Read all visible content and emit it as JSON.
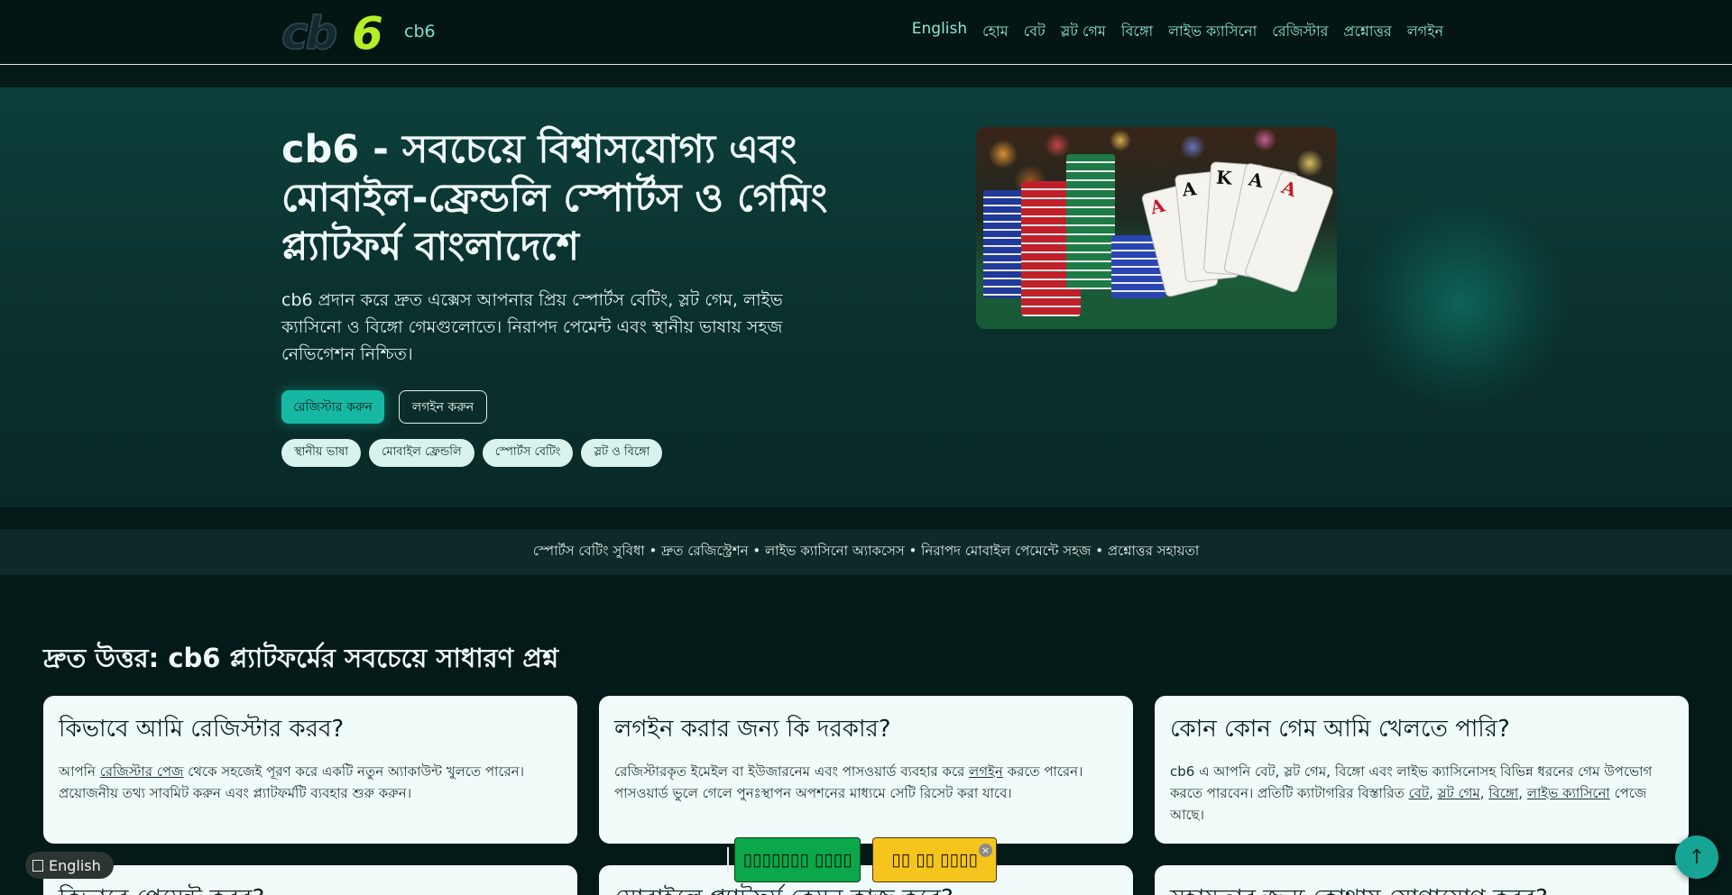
{
  "header": {
    "logo_text": "cb6",
    "brand": "cb6",
    "nav": {
      "language": "English",
      "home": "হোম",
      "bet": "বেট",
      "slot": "স্লট গেম",
      "bingo": "বিঙ্গো",
      "live_casino": "লাইভ ক্যাসিনো",
      "register": "রেজিস্টার",
      "faq": "প্রশ্নোত্তর",
      "login": "লগইন"
    }
  },
  "hero": {
    "title": "cb6 - সবচেয়ে বিশ্বাসযোগ্য এবং মোবাইল-ফ্রেন্ডলি স্পোর্টস ও গেমিং প্ল্যাটফর্ম বাংলাদেশে",
    "description": "cb6 প্রদান করে দ্রুত এক্সেস আপনার প্রিয় স্পোর্টস বেটিং, স্লট গেম, লাইভ ক্যাসিনো ও বিঙ্গো গেমগুলোতে। নিরাপদ পেমেন্ট এবং স্থানীয় ভাষায় সহজ নেভিগেশন নিশ্চিত।",
    "register_button": "রেজিস্টার করুন",
    "login_button": "লগইন করুন",
    "chips": [
      "স্থানীয় ভাষা",
      "মোবাইল ফ্রেন্ডলি",
      "স্পোর্টস বেটিং",
      "স্লট ও বিঙ্গো"
    ]
  },
  "ticker": "স্পোর্টস বেটিং সুবিধা • দ্রুত রেজিস্ট্রেশন • লাইভ ক্যাসিনো অ্যাকসেস • নিরাপদ মোবাইল পেমেন্টে সহজ • প্রশ্নোত্তর সহায়তা",
  "faq": {
    "title": "দ্রুত উত্তর: cb6 প্ল্যাটফর্মের সবচেয়ে সাধারণ প্রশ্ন",
    "cards": [
      {
        "question": "কিভাবে আমি রেজিস্টার করব?",
        "p1": "আপনি ",
        "link1": "রেজিস্টার পেজ",
        "p2": " থেকে সহজেই পূরণ করে একটি নতুন অ্যাকাউন্ট খুলতে পারেন। প্রয়োজনীয় তথ্য সাবমিট করুন এবং প্ল্যাটফর্মটি ব্যবহার শুরু করুন।"
      },
      {
        "question": "লগইন করার জন্য কি দরকার?",
        "p1": "রেজিস্টারকৃত ইমেইল বা ইউজারনেম এবং পাসওয়ার্ড ব্যবহার করে ",
        "link1": "লগইন",
        "p2": " করতে পারেন। পাসওয়ার্ড ভুলে গেলে পুনঃস্থাপন অপশনের মাধ্যমে সেটি রিসেট করা যাবে।"
      },
      {
        "question": "কোন কোন গেম আমি খেলতে পারি?",
        "p1": "cb6 এ আপনি বেট, স্লট গেম, বিঙ্গো এবং লাইভ ক্যাসিনোসহ বিভিন্ন ধরনের গেম উপভোগ করতে পারবেন। প্রতিটি ক্যাটাগরির বিস্তারিত ",
        "link1": "বেট",
        "sep1": ", ",
        "link2": "স্লট গেম",
        "sep2": ", ",
        "link3": "বিঙ্গো",
        "sep3": ", ",
        "link4": "লাইভ ক্যাসিনো",
        "p2": " পেজে আছে।"
      },
      {
        "question": "কিভাবে পেমেন্ট করব?"
      },
      {
        "question": "মোবাইলে প্ল্যাটফর্ম কেমন কাজ করে?"
      },
      {
        "question": "সহায়তার জন্য কোথায় যোগাযোগ করব?"
      }
    ]
  },
  "floating": {
    "language": "English",
    "promo_green": "▯▯▯▯▯▯▯ ▯▯▯▯",
    "promo_yellow": "▯▯ ▯▯ ▯▯▯▯",
    "close": "×",
    "scroll_top": "↑"
  },
  "colors": {
    "background": "#041a18",
    "accent": "#16b8a3",
    "logo_lime": "#b4f02a",
    "card_bg": "#f1fbf9",
    "promo_green": "#0aa84a",
    "promo_yellow": "#f5c51e"
  }
}
